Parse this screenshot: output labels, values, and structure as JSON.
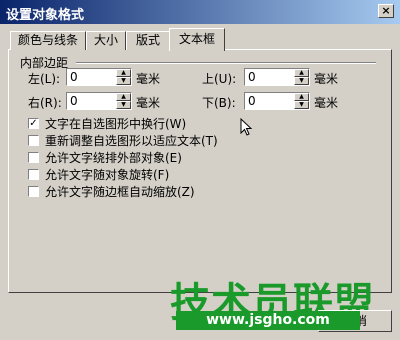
{
  "window": {
    "title": "设置对象格式",
    "close": "×"
  },
  "tabs": [
    "颜色与线条",
    "大小",
    "版式",
    "文本框"
  ],
  "group": {
    "label": "内部边距"
  },
  "margins": {
    "left": {
      "label": "左(L):",
      "value": "0",
      "unit": "毫米"
    },
    "right": {
      "label": "右(R):",
      "value": "0",
      "unit": "毫米"
    },
    "top": {
      "label": "上(U):",
      "value": "0",
      "unit": "毫米"
    },
    "bottom": {
      "label": "下(B):",
      "value": "0",
      "unit": "毫米"
    }
  },
  "options": [
    {
      "label": "文字在自选图形中换行(W)",
      "checked": true
    },
    {
      "label": "重新调整自选图形以适应文本(T)",
      "checked": false
    },
    {
      "label": "允许文字绕排外部对象(E)",
      "checked": false
    },
    {
      "label": "允许文字随对象旋转(F)",
      "checked": false
    },
    {
      "label": "允许文字随边框自动缩放(Z)",
      "checked": false
    }
  ],
  "watermark": {
    "text": "技术员联盟",
    "url": "www.jsgho.com"
  },
  "buttons": {
    "cancel": "取消"
  }
}
